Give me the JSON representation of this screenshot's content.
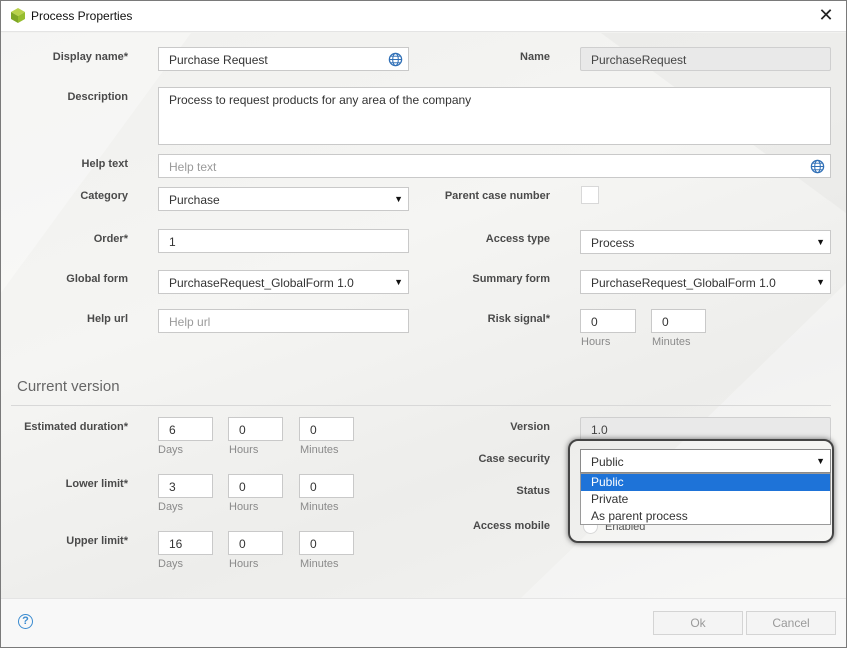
{
  "window": {
    "title": "Process Properties"
  },
  "fields": {
    "display_name": {
      "label": "Display name*",
      "value": "Purchase Request"
    },
    "name": {
      "label": "Name",
      "value": "PurchaseRequest"
    },
    "description": {
      "label": "Description",
      "value": "Process to request products for any area of the company"
    },
    "help_text": {
      "label": "Help text",
      "placeholder": "Help text"
    },
    "category": {
      "label": "Category",
      "value": "Purchase"
    },
    "parent_case_number": {
      "label": "Parent case number",
      "checked": false
    },
    "order": {
      "label": "Order*",
      "value": "1"
    },
    "access_type": {
      "label": "Access type",
      "value": "Process"
    },
    "global_form": {
      "label": "Global form",
      "value": "PurchaseRequest_GlobalForm 1.0"
    },
    "summary_form": {
      "label": "Summary form",
      "value": "PurchaseRequest_GlobalForm 1.0"
    },
    "help_url": {
      "label": "Help url",
      "placeholder": "Help url"
    },
    "risk_signal": {
      "label": "Risk signal*",
      "hours": "0",
      "minutes": "0",
      "hours_label": "Hours",
      "minutes_label": "Minutes"
    }
  },
  "current_version": {
    "title": "Current version",
    "estimated_duration": {
      "label": "Estimated duration*",
      "days": "6",
      "hours": "0",
      "minutes": "0"
    },
    "lower_limit": {
      "label": "Lower limit*",
      "days": "3",
      "hours": "0",
      "minutes": "0"
    },
    "upper_limit": {
      "label": "Upper limit*",
      "days": "16",
      "hours": "0",
      "minutes": "0"
    },
    "units": {
      "days": "Days",
      "hours": "Hours",
      "minutes": "Minutes"
    },
    "version": {
      "label": "Version",
      "value": "1.0"
    },
    "case_security": {
      "label": "Case security",
      "value": "Public",
      "options": [
        "Public",
        "Private",
        "As parent process"
      ],
      "selected_index": 0
    },
    "status": {
      "label": "Status"
    },
    "access_mobile": {
      "label": "Access mobile",
      "checkbox_label": "Enabled"
    }
  },
  "footer": {
    "ok_label": "Ok",
    "cancel_label": "Cancel",
    "help_glyph": "?"
  },
  "colors": {
    "accent": "#1e73d8",
    "globe": "#2f6fb6",
    "help": "#3a8bd0"
  }
}
